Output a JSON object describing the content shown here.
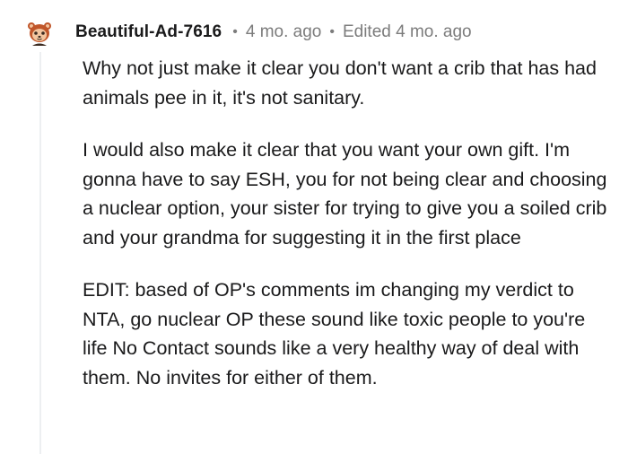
{
  "comment": {
    "author": "Beautiful-Ad-7616",
    "timestamp": "4 mo. ago",
    "edited": "Edited 4 mo. ago",
    "separator": "•",
    "paragraphs": [
      "Why not just make it clear you don't want a crib that has had animals pee in it, it's not sanitary.",
      "I would also make it clear that you want your own gift. I'm gonna have to say ESH, you for not being clear and choosing a nuclear option, your sister for trying to give you a soiled crib and your grandma for suggesting it in the first place",
      "EDIT: based of OP's comments im changing my verdict to NTA, go nuclear OP these sound like toxic people to you're life No Contact sounds like a very healthy way of deal with them. No invites for either of them."
    ]
  },
  "avatar": {
    "icon": "snoo-avatar-icon",
    "colors": {
      "face": "#f3c6a0",
      "accent": "#c0562a",
      "dark": "#3a2a20"
    }
  },
  "theme": {
    "thread_line": "#edeff1",
    "meta_text": "#7c7c7c",
    "body_text": "#1a1a1b"
  }
}
